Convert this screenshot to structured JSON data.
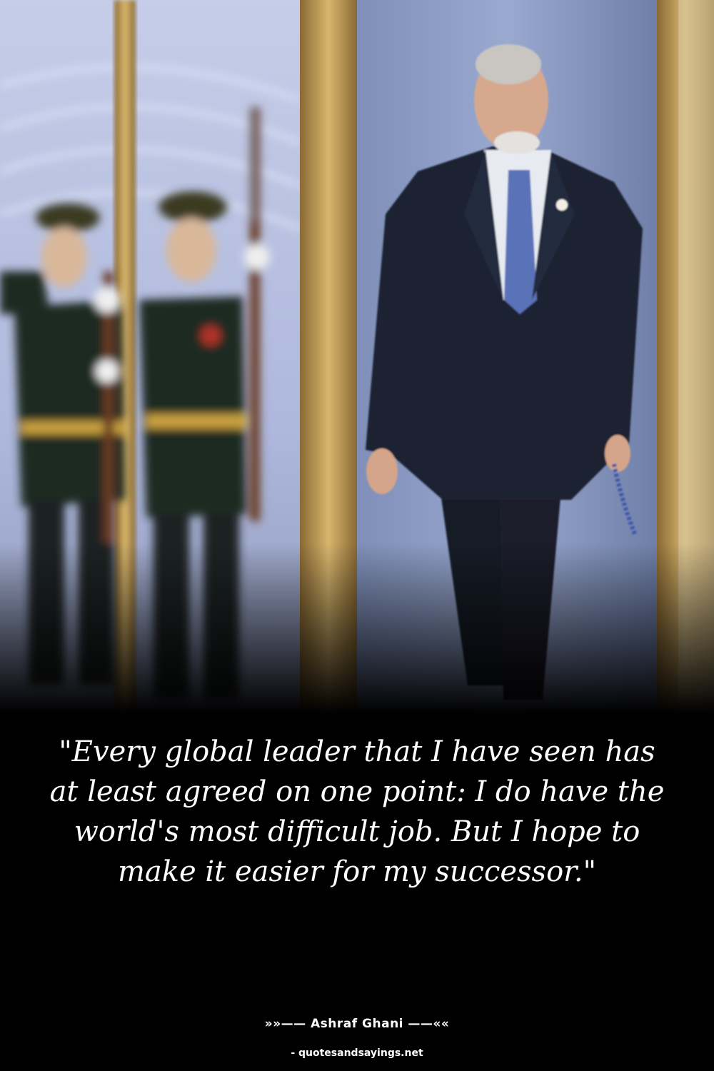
{
  "quote": {
    "text": "\"Every global leader that I have seen has at least agreed on one point: I do have the world's most difficult job. But I hope to make it easier for my successor.\""
  },
  "attribution": {
    "author_line": "»»—— Ashraf Ghani ——««"
  },
  "source": {
    "site": "- quotesandsayings.net"
  },
  "colors": {
    "background": "#000000",
    "text": "#ffffff",
    "suit": "#1c2233",
    "wall": "#b9c3e0",
    "frame_gold": "#c9a45a"
  }
}
